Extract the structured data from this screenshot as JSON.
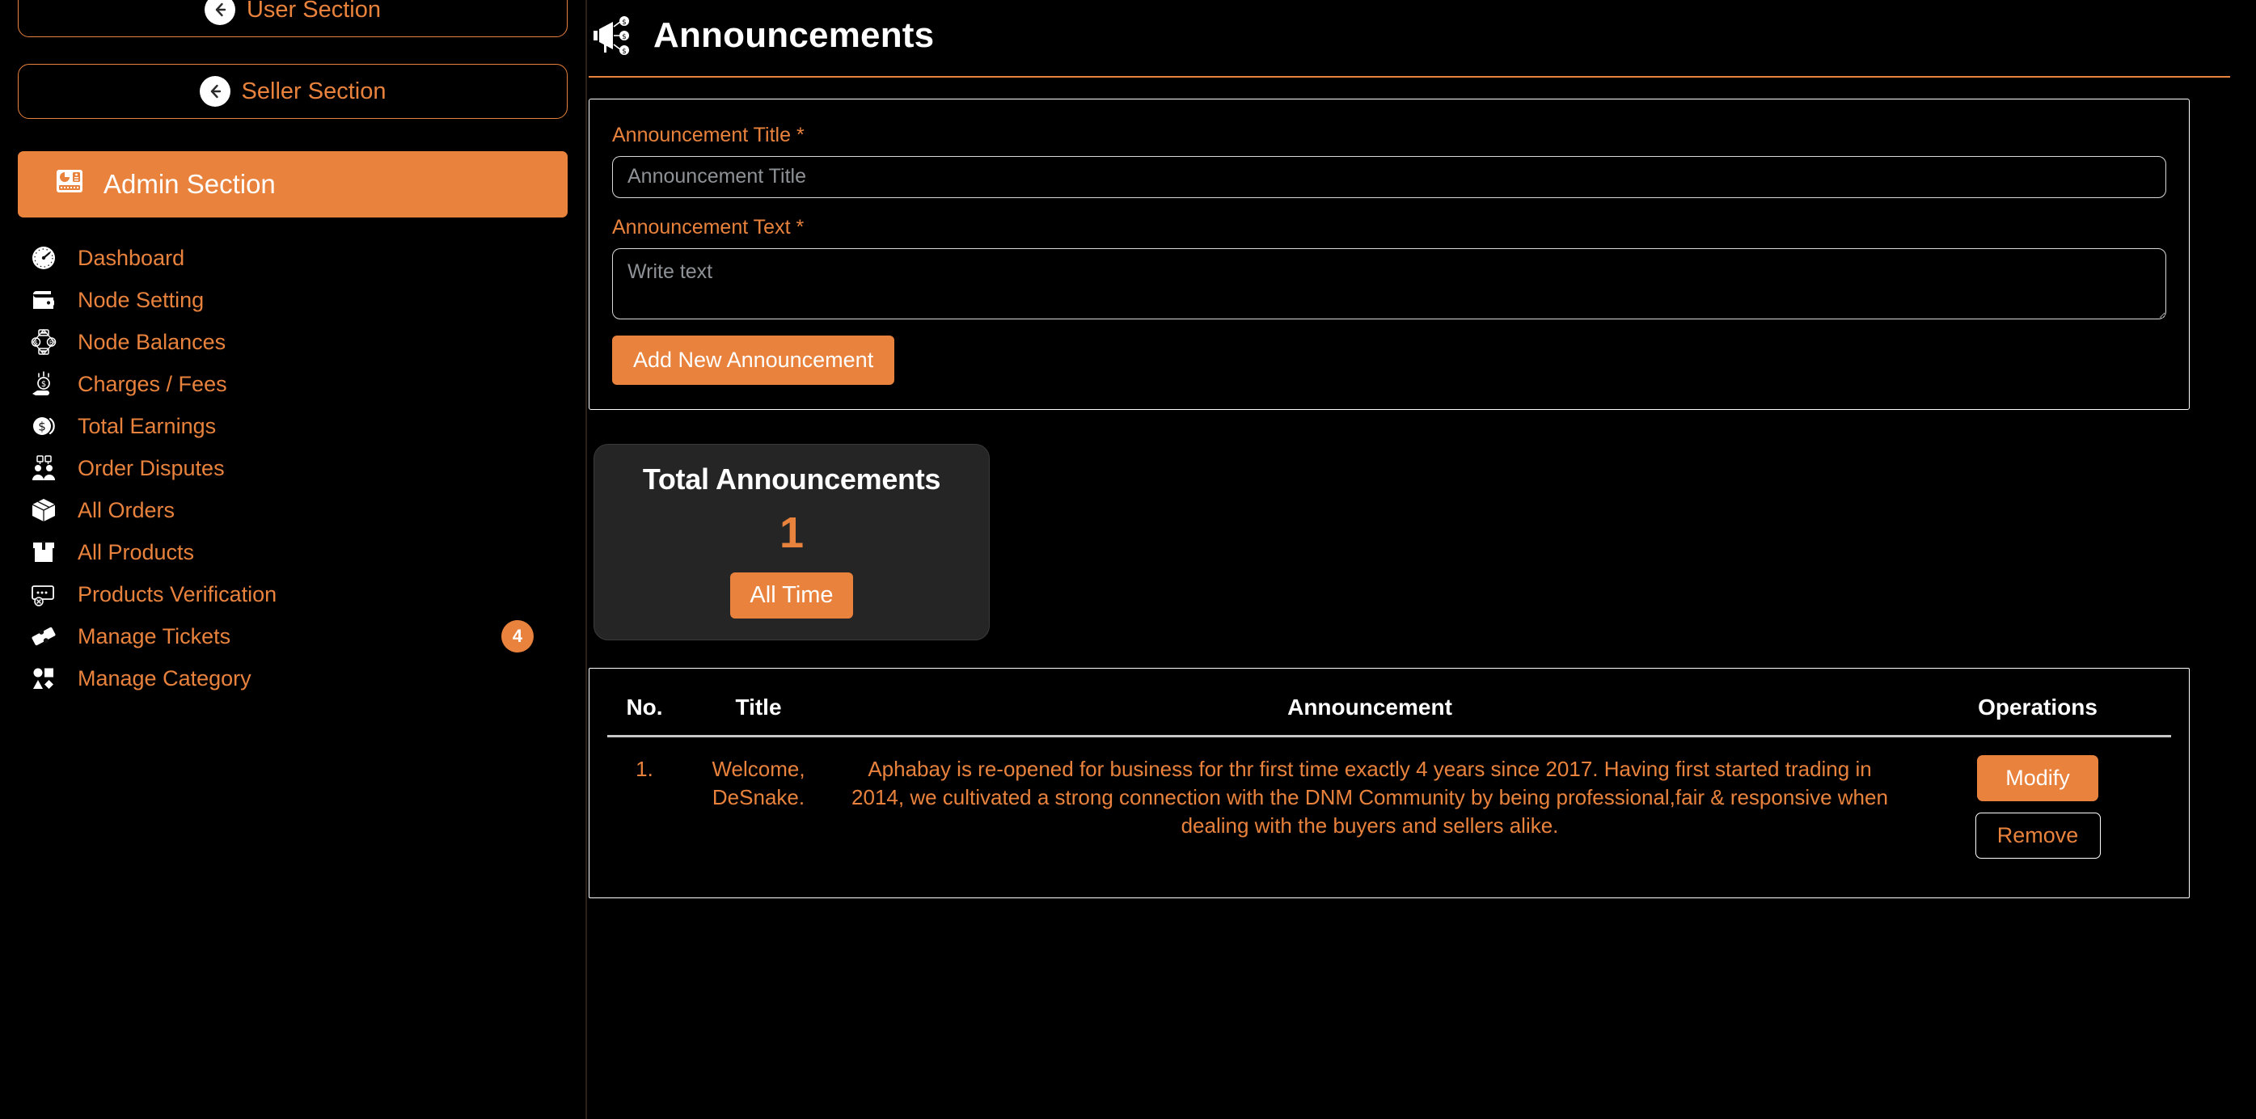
{
  "theme": {
    "accent": "#e8823c",
    "background": "#000000",
    "card_bg": "#252525",
    "text_light": "#ffffff",
    "placeholder": "#8e9296"
  },
  "sidebar": {
    "section_buttons": [
      {
        "label": "User Section",
        "icon": "back-arrow-icon"
      },
      {
        "label": "Seller Section",
        "icon": "back-arrow-icon"
      }
    ],
    "active_banner": {
      "label": "Admin Section",
      "icon": "dashboard-panel-icon"
    },
    "items": [
      {
        "label": "Dashboard",
        "icon": "speedometer-icon",
        "badge": ""
      },
      {
        "label": "Node Setting",
        "icon": "wallet-icon",
        "badge": ""
      },
      {
        "label": "Node Balances",
        "icon": "node-exchange-icon",
        "badge": ""
      },
      {
        "label": "Charges / Fees",
        "icon": "hand-coin-icon",
        "badge": ""
      },
      {
        "label": "Total Earnings",
        "icon": "coin-icon",
        "badge": ""
      },
      {
        "label": "Order Disputes",
        "icon": "two-people-icon",
        "badge": ""
      },
      {
        "label": "All Orders",
        "icon": "box-icon",
        "badge": ""
      },
      {
        "label": "All Products",
        "icon": "open-box-icon",
        "badge": ""
      },
      {
        "label": "Products Verification",
        "icon": "verify-card-icon",
        "badge": ""
      },
      {
        "label": "Manage Tickets",
        "icon": "ticket-icon",
        "badge": "4"
      },
      {
        "label": "Manage Category",
        "icon": "shapes-icon",
        "badge": ""
      }
    ]
  },
  "main": {
    "page_title": "Announcements",
    "page_icon": "megaphone-coins-icon",
    "form": {
      "title_label": "Announcement Title",
      "title_required_mark": "*",
      "title_placeholder": "Announcement Title",
      "title_value": "",
      "text_label": "Announcement Text",
      "text_required_mark": "*",
      "text_placeholder": "Write text",
      "text_value": "",
      "submit_label": "Add New Announcement"
    },
    "stat": {
      "title": "Total Announcements",
      "value": "1",
      "range_label": "All Time"
    },
    "table": {
      "headers": {
        "no": "No.",
        "title": "Title",
        "announcement": "Announcement",
        "operations": "Operations"
      },
      "rows": [
        {
          "no": "1.",
          "title": "Welcome, DeSnake.",
          "announcement": "Aphabay is re-opened for business for thr first time exactly 4 years since 2017. Having first started trading in 2014, we cultivated a strong connection with the DNM Community by being professional,fair & responsive when dealing with the buyers and sellers alike.",
          "modify_label": "Modify",
          "remove_label": "Remove"
        }
      ]
    }
  }
}
